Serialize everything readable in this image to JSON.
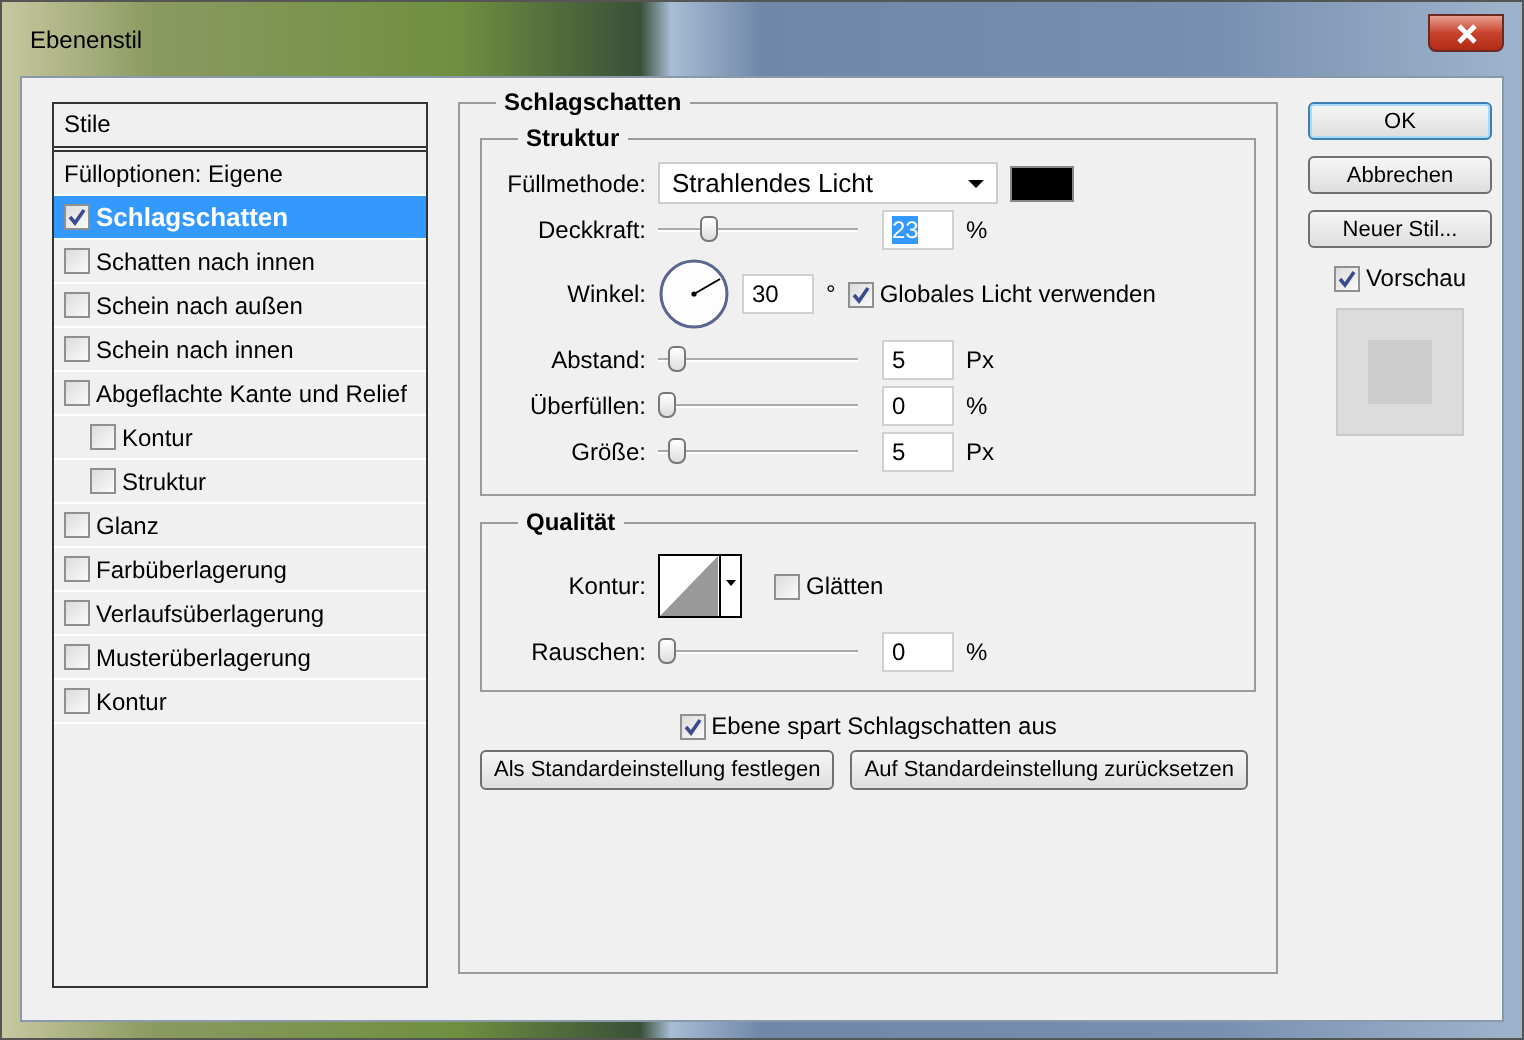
{
  "window": {
    "title": "Ebenenstil"
  },
  "styles": {
    "header": "Stile",
    "items": [
      {
        "kind": "plain",
        "label": "Fülloptionen: Eigene",
        "selected": false
      },
      {
        "kind": "check",
        "label": "Schlagschatten",
        "checked": true,
        "selected": true
      },
      {
        "kind": "check",
        "label": "Schatten nach innen",
        "checked": false,
        "selected": false
      },
      {
        "kind": "check",
        "label": "Schein nach außen",
        "checked": false,
        "selected": false
      },
      {
        "kind": "check",
        "label": "Schein nach innen",
        "checked": false,
        "selected": false
      },
      {
        "kind": "check",
        "label": "Abgeflachte Kante und Relief",
        "checked": false,
        "selected": false,
        "children": [
          {
            "kind": "check",
            "label": "Kontur",
            "checked": false,
            "selected": false
          },
          {
            "kind": "check",
            "label": "Struktur",
            "checked": false,
            "selected": false
          }
        ]
      },
      {
        "kind": "check",
        "label": "Glanz",
        "checked": false,
        "selected": false
      },
      {
        "kind": "check",
        "label": "Farbüberlagerung",
        "checked": false,
        "selected": false
      },
      {
        "kind": "check",
        "label": "Verlaufsüberlagerung",
        "checked": false,
        "selected": false
      },
      {
        "kind": "check",
        "label": "Musterüberlagerung",
        "checked": false,
        "selected": false
      },
      {
        "kind": "check",
        "label": "Kontur",
        "checked": false,
        "selected": false
      }
    ]
  },
  "panel": {
    "title": "Schlagschatten",
    "structure": {
      "title": "Struktur",
      "rows": [
        {
          "kind": "blend",
          "label": "Füllmethode:",
          "value": "Strahlendes Licht"
        },
        {
          "kind": "slider",
          "label": "Deckkraft:",
          "level": 0.23,
          "value": "23",
          "unit": "%",
          "focused": true
        },
        {
          "kind": "angle",
          "label": "Winkel:",
          "value": "30",
          "unit": "°",
          "option": {
            "label": "Globales Licht verwenden",
            "checked": true
          }
        },
        {
          "kind": "slider",
          "label": "Abstand:",
          "level": 0.05,
          "value": "5",
          "unit": "Px",
          "focused": false
        },
        {
          "kind": "slider",
          "label": "Überfüllen:",
          "level": 0,
          "value": "0",
          "unit": "%",
          "focused": false
        },
        {
          "kind": "slider",
          "label": "Größe:",
          "level": 0.05,
          "value": "5",
          "unit": "Px",
          "focused": false
        }
      ]
    },
    "quality": {
      "title": "Qualität",
      "rows": [
        {
          "kind": "contour",
          "label": "Kontur:",
          "option": {
            "label": "Glätten",
            "checked": false
          }
        },
        {
          "kind": "slider",
          "label": "Rauschen:",
          "level": 0,
          "value": "0",
          "unit": "%",
          "focused": false
        }
      ]
    },
    "knockout": {
      "label": "Ebene spart Schlagschatten aus",
      "checked": true
    },
    "buttons": [
      "Als Standardeinstellung festlegen",
      "Auf Standardeinstellung zurücksetzen"
    ]
  },
  "actions": [
    {
      "label": "OK",
      "default": true
    },
    {
      "label": "Abbrechen",
      "default": false
    },
    {
      "label": "Neuer Stil...",
      "default": false
    }
  ],
  "preview": {
    "label": "Vorschau",
    "checked": true
  }
}
